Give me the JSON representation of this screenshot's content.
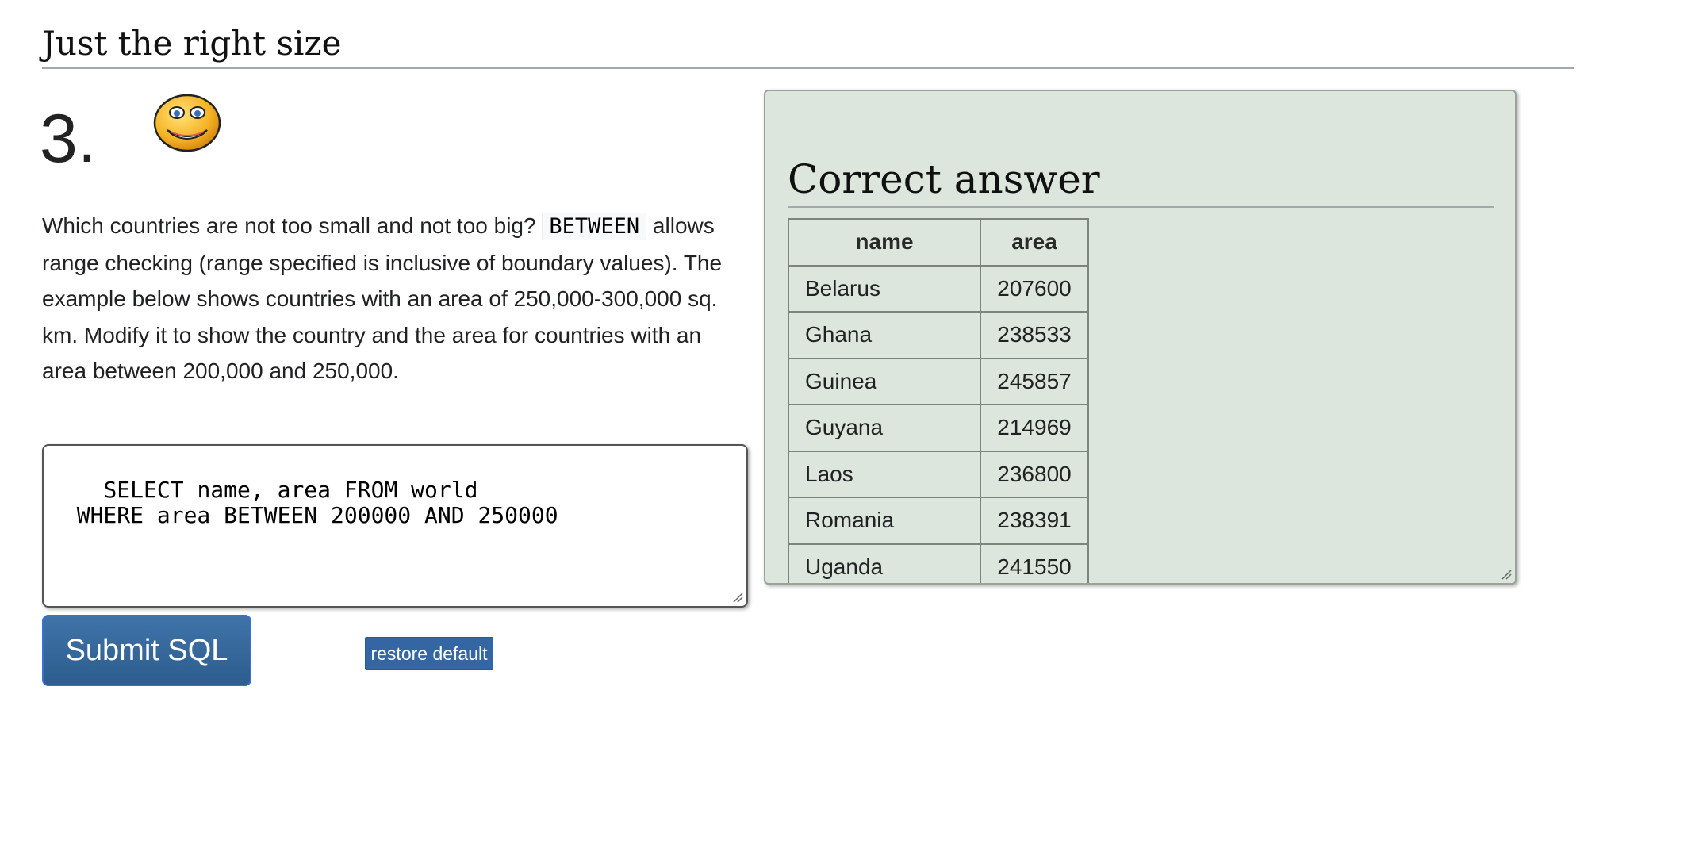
{
  "section": {
    "title": "Just the right size"
  },
  "question": {
    "number": "3.",
    "emoji_icon": "smiley-face-icon",
    "text_before": "Which countries are not too small and not too big? ",
    "keyword": "BETWEEN",
    "text_after": " allows range checking (range specified is inclusive of boundary values). The example below shows countries with an area of 250,000-300,000 sq. km. Modify it to show the country and the area for countries with an area between 200,000 and 250,000."
  },
  "editor": {
    "sql": "SELECT name, area FROM world\n  WHERE area BETWEEN 200000 AND 250000"
  },
  "buttons": {
    "submit_label": "Submit SQL",
    "restore_label": "restore default"
  },
  "answer": {
    "title": "Correct answer",
    "columns": [
      "name",
      "area"
    ],
    "rows": [
      [
        "Belarus",
        "207600"
      ],
      [
        "Ghana",
        "238533"
      ],
      [
        "Guinea",
        "245857"
      ],
      [
        "Guyana",
        "214969"
      ],
      [
        "Laos",
        "236800"
      ],
      [
        "Romania",
        "238391"
      ],
      [
        "Uganda",
        "241550"
      ]
    ]
  },
  "colors": {
    "panel_bg": "#dce6dc",
    "button_blue": "#2e5d8e",
    "emoji_yellow": "#f5b324"
  }
}
